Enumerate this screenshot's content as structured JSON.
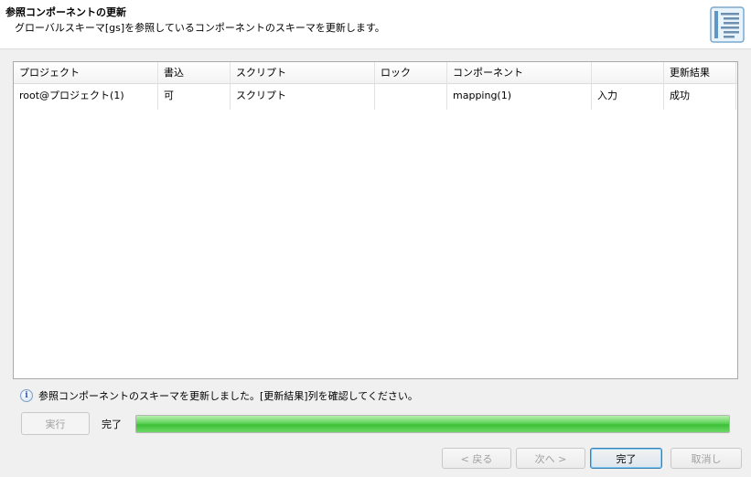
{
  "header": {
    "title": "参照コンポーネントの更新",
    "description": "グローバルスキーマ[gs]を参照しているコンポーネントのスキーマを更新します。",
    "icon": "wizard-document-icon"
  },
  "table": {
    "columns": [
      "プロジェクト",
      "書込",
      "スクリプト",
      "ロック",
      "コンポーネント",
      "",
      "更新結果"
    ],
    "rows": [
      [
        "root@プロジェクト(1)",
        "可",
        "スクリプト",
        "",
        "mapping(1)",
        "入力",
        "成功"
      ]
    ]
  },
  "info": {
    "icon": "info-icon",
    "message": "参照コンポーネントのスキーマを更新しました。[更新結果]列を確認してください。"
  },
  "execution": {
    "run_label": "実行",
    "status": "完了",
    "progress": 1.0
  },
  "buttons": {
    "back": "< 戻る",
    "next": "次へ >",
    "finish": "完了",
    "cancel": "取消し"
  },
  "colors": {
    "progress_green": "#4cc948",
    "default_button_border": "#3c7fb1"
  }
}
